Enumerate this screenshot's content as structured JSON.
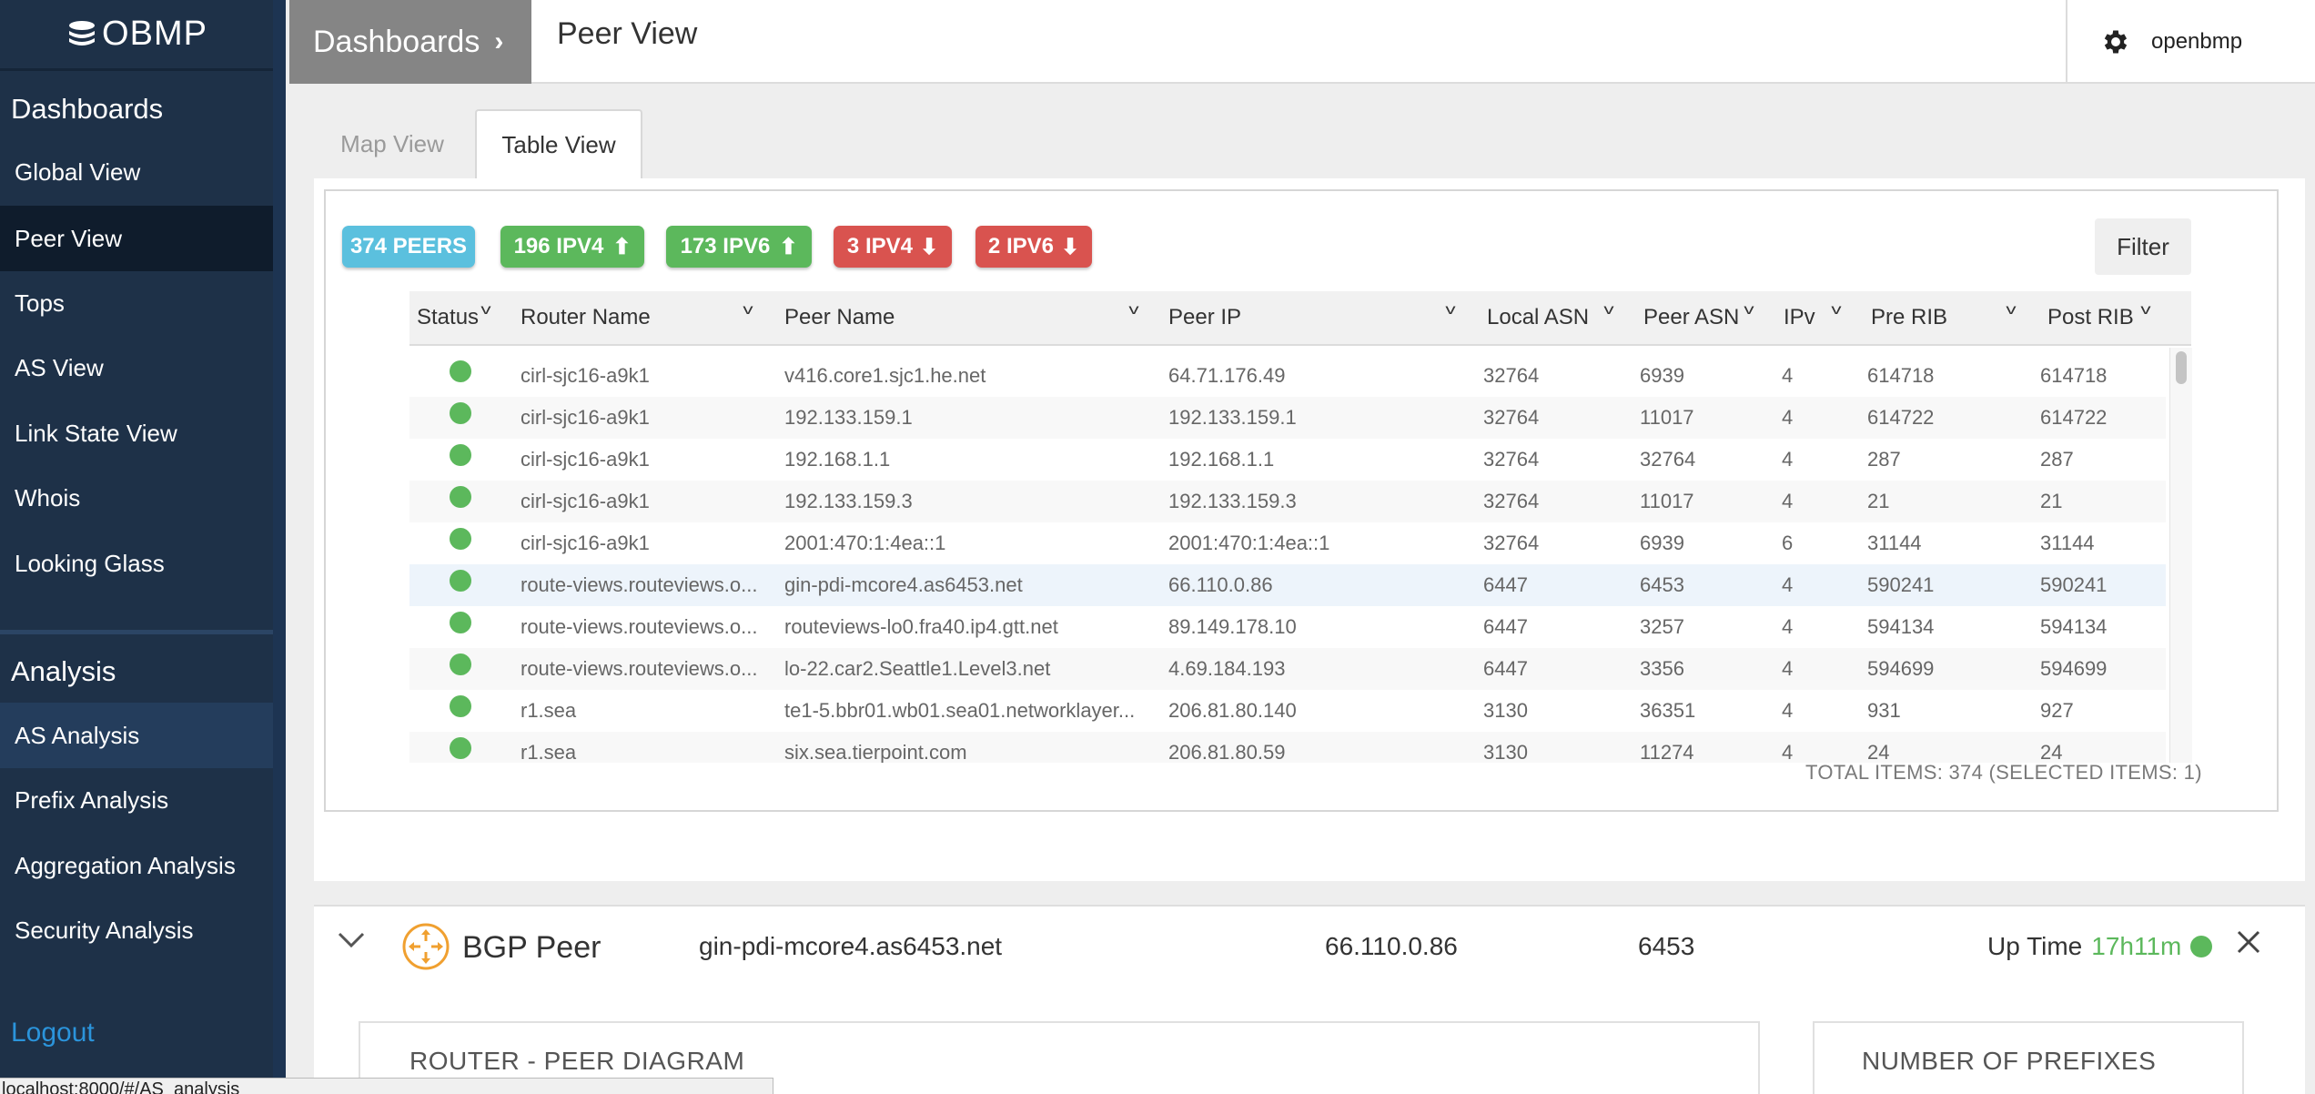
{
  "app": {
    "logo_text": "OBMP"
  },
  "sidebar": {
    "dashboards_heading": "Dashboards",
    "dashboards_items": [
      {
        "label": "Global View"
      },
      {
        "label": "Peer View"
      },
      {
        "label": "Tops"
      },
      {
        "label": "AS View"
      },
      {
        "label": "Link State View"
      },
      {
        "label": "Whois"
      },
      {
        "label": "Looking Glass"
      }
    ],
    "analysis_heading": "Analysis",
    "analysis_items": [
      {
        "label": "AS Analysis"
      },
      {
        "label": "Prefix Analysis"
      },
      {
        "label": "Aggregation Analysis"
      },
      {
        "label": "Security Analysis"
      }
    ],
    "logout_label": "Logout"
  },
  "header": {
    "breadcrumb": "Dashboards",
    "title": "Peer View",
    "username": "openbmp",
    "settings_icon": "gear-icon"
  },
  "tabs": [
    {
      "label": "Map View",
      "active": false
    },
    {
      "label": "Table View",
      "active": true
    }
  ],
  "badges": [
    {
      "label": "374 PEERS",
      "color": "#5bc0de"
    },
    {
      "label": "196 IPV4",
      "color": "#5cb85c",
      "icon": "arrow-up-icon"
    },
    {
      "label": "173 IPV6",
      "color": "#5cb85c",
      "icon": "arrow-up-icon"
    },
    {
      "label": "3 IPV4",
      "color": "#d9534f",
      "icon": "arrow-down-icon"
    },
    {
      "label": "2 IPV6",
      "color": "#d9534f",
      "icon": "arrow-down-icon"
    }
  ],
  "filter_label": "Filter",
  "table": {
    "columns": [
      "Status",
      "Router Name",
      "Peer Name",
      "Peer IP",
      "Local ASN",
      "Peer ASN",
      "IPv",
      "Pre RIB",
      "Post RIB"
    ],
    "rows": [
      {
        "router": "cirl-sjc16-a9k1",
        "peer_name": "v416.core1.sjc1.he.net",
        "peer_ip": "64.71.176.49",
        "local_asn": "32764",
        "peer_asn": "6939",
        "ipv": "4",
        "pre_rib": "614718",
        "post_rib": "614718"
      },
      {
        "router": "cirl-sjc16-a9k1",
        "peer_name": "192.133.159.1",
        "peer_ip": "192.133.159.1",
        "local_asn": "32764",
        "peer_asn": "11017",
        "ipv": "4",
        "pre_rib": "614722",
        "post_rib": "614722"
      },
      {
        "router": "cirl-sjc16-a9k1",
        "peer_name": "192.168.1.1",
        "peer_ip": "192.168.1.1",
        "local_asn": "32764",
        "peer_asn": "32764",
        "ipv": "4",
        "pre_rib": "287",
        "post_rib": "287"
      },
      {
        "router": "cirl-sjc16-a9k1",
        "peer_name": "192.133.159.3",
        "peer_ip": "192.133.159.3",
        "local_asn": "32764",
        "peer_asn": "11017",
        "ipv": "4",
        "pre_rib": "21",
        "post_rib": "21"
      },
      {
        "router": "cirl-sjc16-a9k1",
        "peer_name": "2001:470:1:4ea::1",
        "peer_ip": "2001:470:1:4ea::1",
        "local_asn": "32764",
        "peer_asn": "6939",
        "ipv": "6",
        "pre_rib": "31144",
        "post_rib": "31144"
      },
      {
        "router": "route-views.routeviews.o...",
        "peer_name": "gin-pdi-mcore4.as6453.net",
        "peer_ip": "66.110.0.86",
        "local_asn": "6447",
        "peer_asn": "6453",
        "ipv": "4",
        "pre_rib": "590241",
        "post_rib": "590241"
      },
      {
        "router": "route-views.routeviews.o...",
        "peer_name": "routeviews-lo0.fra40.ip4.gtt.net",
        "peer_ip": "89.149.178.10",
        "local_asn": "6447",
        "peer_asn": "3257",
        "ipv": "4",
        "pre_rib": "594134",
        "post_rib": "594134"
      },
      {
        "router": "route-views.routeviews.o...",
        "peer_name": "lo-22.car2.Seattle1.Level3.net",
        "peer_ip": "4.69.184.193",
        "local_asn": "6447",
        "peer_asn": "3356",
        "ipv": "4",
        "pre_rib": "594699",
        "post_rib": "594699"
      },
      {
        "router": "r1.sea",
        "peer_name": "te1-5.bbr01.wb01.sea01.networklayer...",
        "peer_ip": "206.81.80.140",
        "local_asn": "3130",
        "peer_asn": "36351",
        "ipv": "4",
        "pre_rib": "931",
        "post_rib": "927"
      },
      {
        "router": "r1.sea",
        "peer_name": "six.sea.tierpoint.com",
        "peer_ip": "206.81.80.59",
        "local_asn": "3130",
        "peer_asn": "11274",
        "ipv": "4",
        "pre_rib": "24",
        "post_rib": "24"
      }
    ],
    "total_items": "TOTAL ITEMS: 374 (SELECTED ITEMS: 1)"
  },
  "peer_detail": {
    "title": "BGP Peer",
    "peer_name": "gin-pdi-mcore4.as6453.net",
    "peer_ip": "66.110.0.86",
    "peer_asn": "6453",
    "uptime_label": "Up Time",
    "uptime_value": "17h11m",
    "diagram_title": "ROUTER - PEER DIAGRAM",
    "prefixes_title": "NUMBER OF PREFIXES"
  },
  "status_bar_url": "localhost:8000/#/AS_analysis"
}
